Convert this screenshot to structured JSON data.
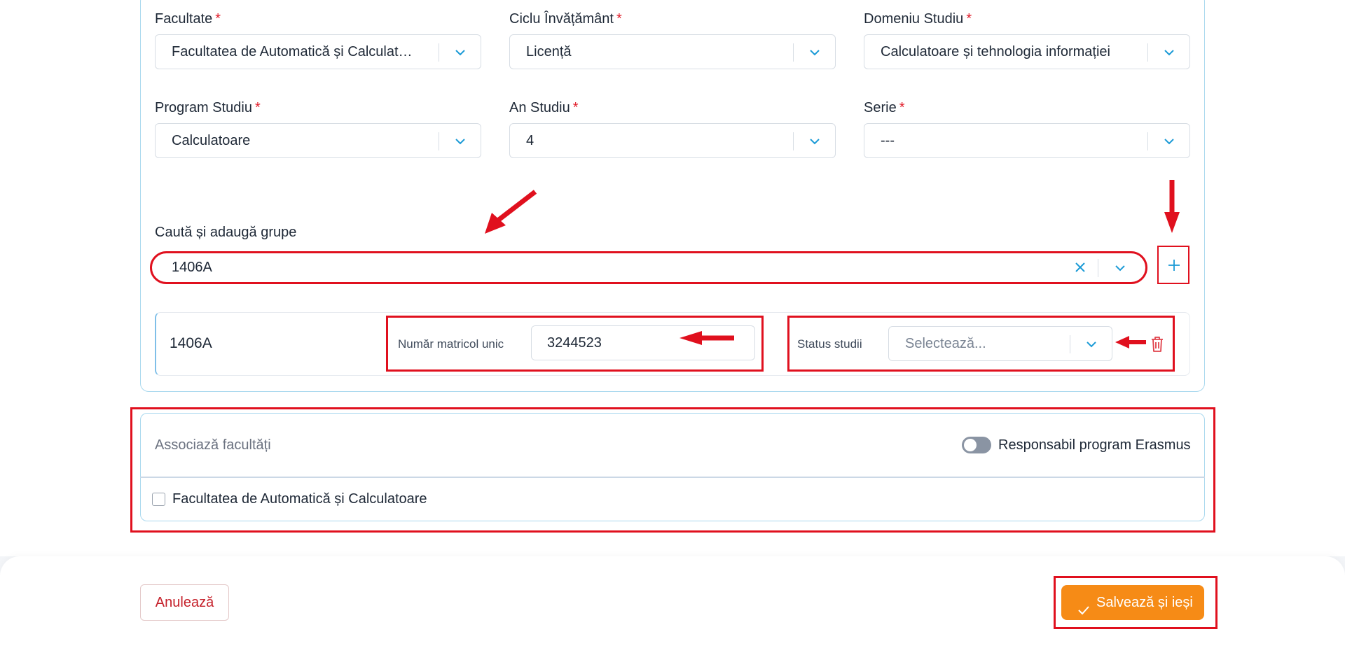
{
  "colors": {
    "accent": "#f68b16",
    "link_blue": "#1a9ad6",
    "required": "#e11d2a",
    "annotation_red": "#e0101e",
    "danger": "#c5202a"
  },
  "form": {
    "facultate": {
      "label": "Facultate",
      "required": "*",
      "value": "Facultatea de Automatică și Calculato..."
    },
    "ciclu": {
      "label": "Ciclu Învățământ",
      "required": "*",
      "value": "Licență"
    },
    "domeniu": {
      "label": "Domeniu Studiu",
      "required": "*",
      "value": "Calculatoare și tehnologia informației"
    },
    "program": {
      "label": "Program Studiu",
      "required": "*",
      "value": "Calculatoare"
    },
    "an": {
      "label": "An Studiu",
      "required": "*",
      "value": "4"
    },
    "serie": {
      "label": "Serie",
      "required": "*",
      "value": "---"
    }
  },
  "groups": {
    "search_label": "Caută și adaugă grupe",
    "search_value": "1406A",
    "add_icon": "plus-icon",
    "row": {
      "group_name": "1406A",
      "matricol_label": "Număr matricol unic",
      "matricol_value": "3244523",
      "status_label": "Status studii",
      "status_placeholder": "Selectează...",
      "delete_icon": "trash-icon"
    }
  },
  "assoc": {
    "title": "Associază facultăți",
    "erasmus_label": "Responsabil program Erasmus",
    "erasmus_on": false,
    "faculty_checkbox_label": "Facultatea de Automatică și Calculatoare",
    "faculty_checked": false
  },
  "footer": {
    "cancel_label": "Anulează",
    "save_label": "Salvează și ieși",
    "save_icon": "check-icon"
  }
}
